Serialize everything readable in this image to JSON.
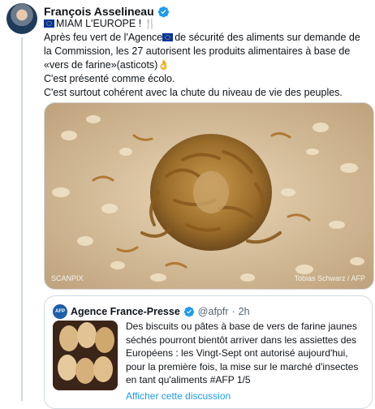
{
  "tweet": {
    "author": {
      "name": "François Asselineau",
      "verified": true
    },
    "lines": [
      "MIAM L'EUROPE !",
      "Après feu vert de l'Agence",
      "de sécurité des aliments sur demande de la Commission, les 27 autorisent les produits alimentaires à base de «vers de farine»(asticots)",
      "C'est présenté comme écolo.",
      "C'est surtout cohérent avec la chute du niveau de vie des peuples."
    ],
    "media": {
      "credit_left": "SCANPIX",
      "credit_right": "Tobias Schwarz / AFP"
    }
  },
  "quote": {
    "author_name": "Agence France-Presse",
    "verified": true,
    "handle": "@afpfr",
    "separator": "·",
    "time": "2h",
    "logo_text": "AFP",
    "text": "Des biscuits ou pâtes à base de vers de farine jaunes séchés pourront bientôt arriver dans les assiettes des Européens : les Vingt-Sept ont autorisé aujourd'hui, pour la première fois, la mise sur le marché d'insectes en tant qu'aliments #AFP 1/5",
    "show_thread": "Afficher cette discussion"
  },
  "colors": {
    "accent": "#1d9bf0",
    "eu_blue": "#0033a0",
    "afp_blue": "#1d5ea8"
  },
  "icons": [
    "verified-badge-icon",
    "eu-flag-icon",
    "fork-knife-icon",
    "ok-hand-icon"
  ]
}
